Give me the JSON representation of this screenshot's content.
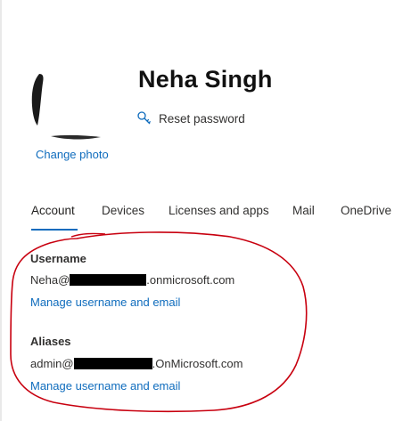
{
  "profile": {
    "name": "Neha Singh",
    "change_photo_label": "Change photo",
    "reset_password_label": "Reset password"
  },
  "tabs": [
    {
      "label": "Account",
      "active": true
    },
    {
      "label": "Devices",
      "active": false
    },
    {
      "label": "Licenses and apps",
      "active": false
    },
    {
      "label": "Mail",
      "active": false
    },
    {
      "label": "OneDrive",
      "active": false
    }
  ],
  "account": {
    "username_label": "Username",
    "username_prefix": "Neha@",
    "username_suffix": ".onmicrosoft.com",
    "manage_username_link_1": "Manage username and email",
    "aliases_label": "Aliases",
    "alias_prefix": "admin@",
    "alias_suffix": ".OnMicrosoft.com",
    "manage_username_link_2": "Manage username and email"
  },
  "colors": {
    "link": "#0f6cbd",
    "annotation": "#c8000f",
    "redaction": "#000000"
  }
}
